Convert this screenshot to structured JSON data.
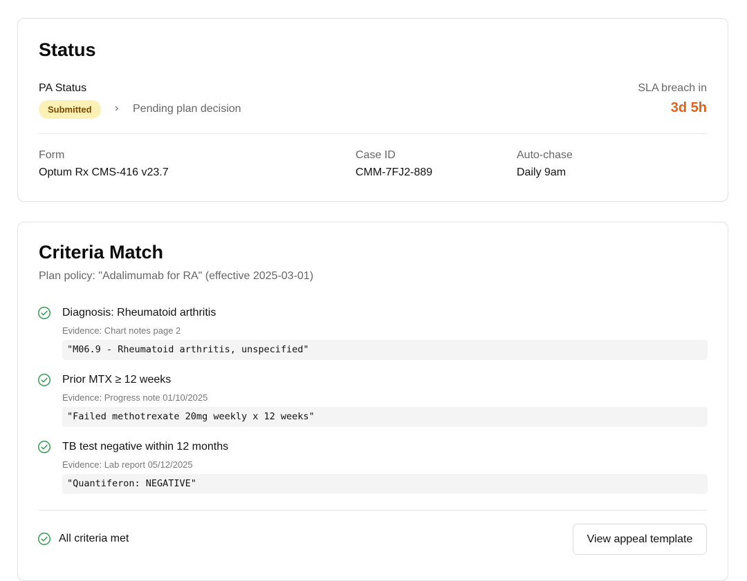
{
  "colors": {
    "accent_orange": "#e0621c",
    "badge_bg": "#fcf1b4",
    "badge_text": "#7a4a06",
    "check_green": "#3fa35a"
  },
  "status": {
    "title": "Status",
    "pa_label": "PA Status",
    "badge": "Submitted",
    "chevron": "›",
    "pending": "Pending plan decision",
    "sla_label": "SLA breach in",
    "sla_value": "3d 5h",
    "form_label": "Form",
    "form_value": "Optum Rx CMS-416 v23.7",
    "case_label": "Case ID",
    "case_value": "CMM-7FJ2-889",
    "chase_label": "Auto-chase",
    "chase_value": "Daily 9am"
  },
  "criteria": {
    "title": "Criteria Match",
    "policy": "Plan policy: \"Adalimumab for RA\" (effective 2025-03-01)",
    "items": [
      {
        "title": "Diagnosis: Rheumatoid arthritis",
        "evidence": "Evidence: Chart notes page 2",
        "quote": "\"M06.9 - Rheumatoid arthritis, unspecified\"",
        "icon": "check-circle-icon"
      },
      {
        "title": "Prior MTX ≥ 12 weeks",
        "evidence": "Evidence: Progress note 01/10/2025",
        "quote": "\"Failed methotrexate 20mg weekly x 12 weeks\"",
        "icon": "check-circle-icon"
      },
      {
        "title": "TB test negative within 12 months",
        "evidence": "Evidence: Lab report 05/12/2025",
        "quote": "\"Quantiferon: NEGATIVE\"",
        "icon": "check-circle-icon"
      }
    ],
    "all_met": "All criteria met",
    "appeal_button": "View appeal template"
  }
}
